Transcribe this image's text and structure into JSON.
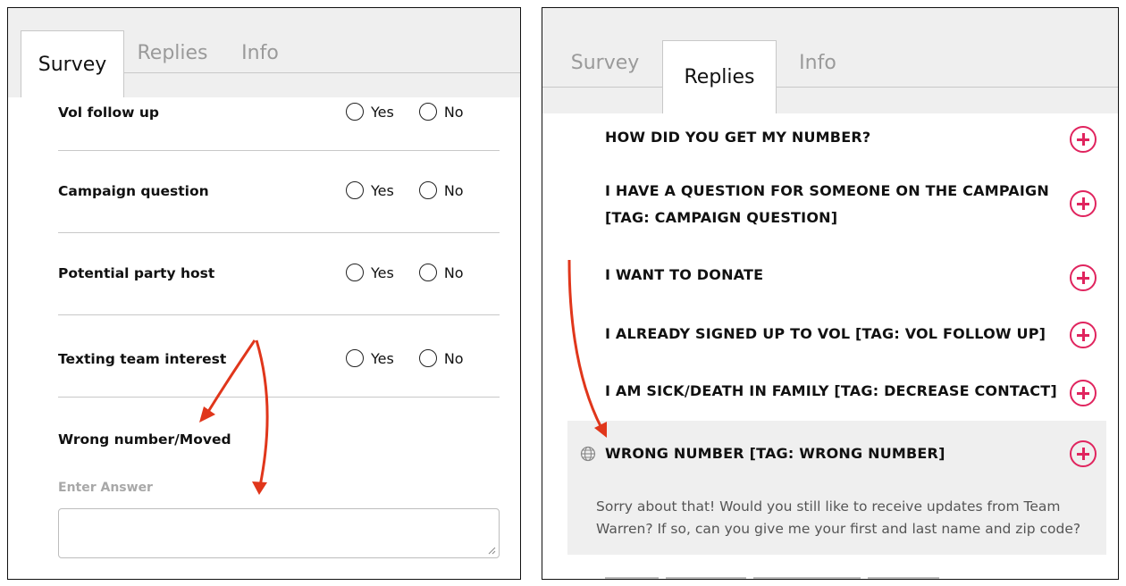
{
  "left_panel": {
    "tabs": [
      "Survey",
      "Replies",
      "Info"
    ],
    "questions": [
      {
        "label": "Vol follow up",
        "yes": "Yes",
        "no": "No"
      },
      {
        "label": "Campaign question",
        "yes": "Yes",
        "no": "No"
      },
      {
        "label": "Potential party host",
        "yes": "Yes",
        "no": "No"
      },
      {
        "label": "Texting team interest",
        "yes": "Yes",
        "no": "No"
      }
    ],
    "wrong_number_label": "Wrong number/Moved",
    "answer_placeholder": "Enter Answer"
  },
  "right_panel": {
    "tabs": [
      "Survey",
      "Replies",
      "Info"
    ],
    "replies": [
      {
        "line1": "HOW DID YOU GET MY NUMBER?"
      },
      {
        "line1": "I HAVE A QUESTION FOR SOMEONE ON THE CAMPAIGN",
        "line2": "[TAG: CAMPAIGN QUESTION]"
      },
      {
        "line1": "I WANT TO DONATE"
      },
      {
        "line1": "I ALREADY SIGNED UP TO VOL [TAG: VOL FOLLOW UP]"
      },
      {
        "line1": "I AM SICK/DEATH IN FAMILY [TAG: DECREASE CONTACT]"
      },
      {
        "line1": "WRONG NUMBER [TAG: WRONG NUMBER]"
      }
    ],
    "expanded_body": "Sorry about that! Would you still like to receive updates from Team Warren? If so, can you give me your first and last name and zip code?"
  },
  "colors": {
    "accent": "#e0245e",
    "arrow": "#e0361b",
    "tab_bg": "#efefef",
    "border": "#c8c8c8"
  }
}
